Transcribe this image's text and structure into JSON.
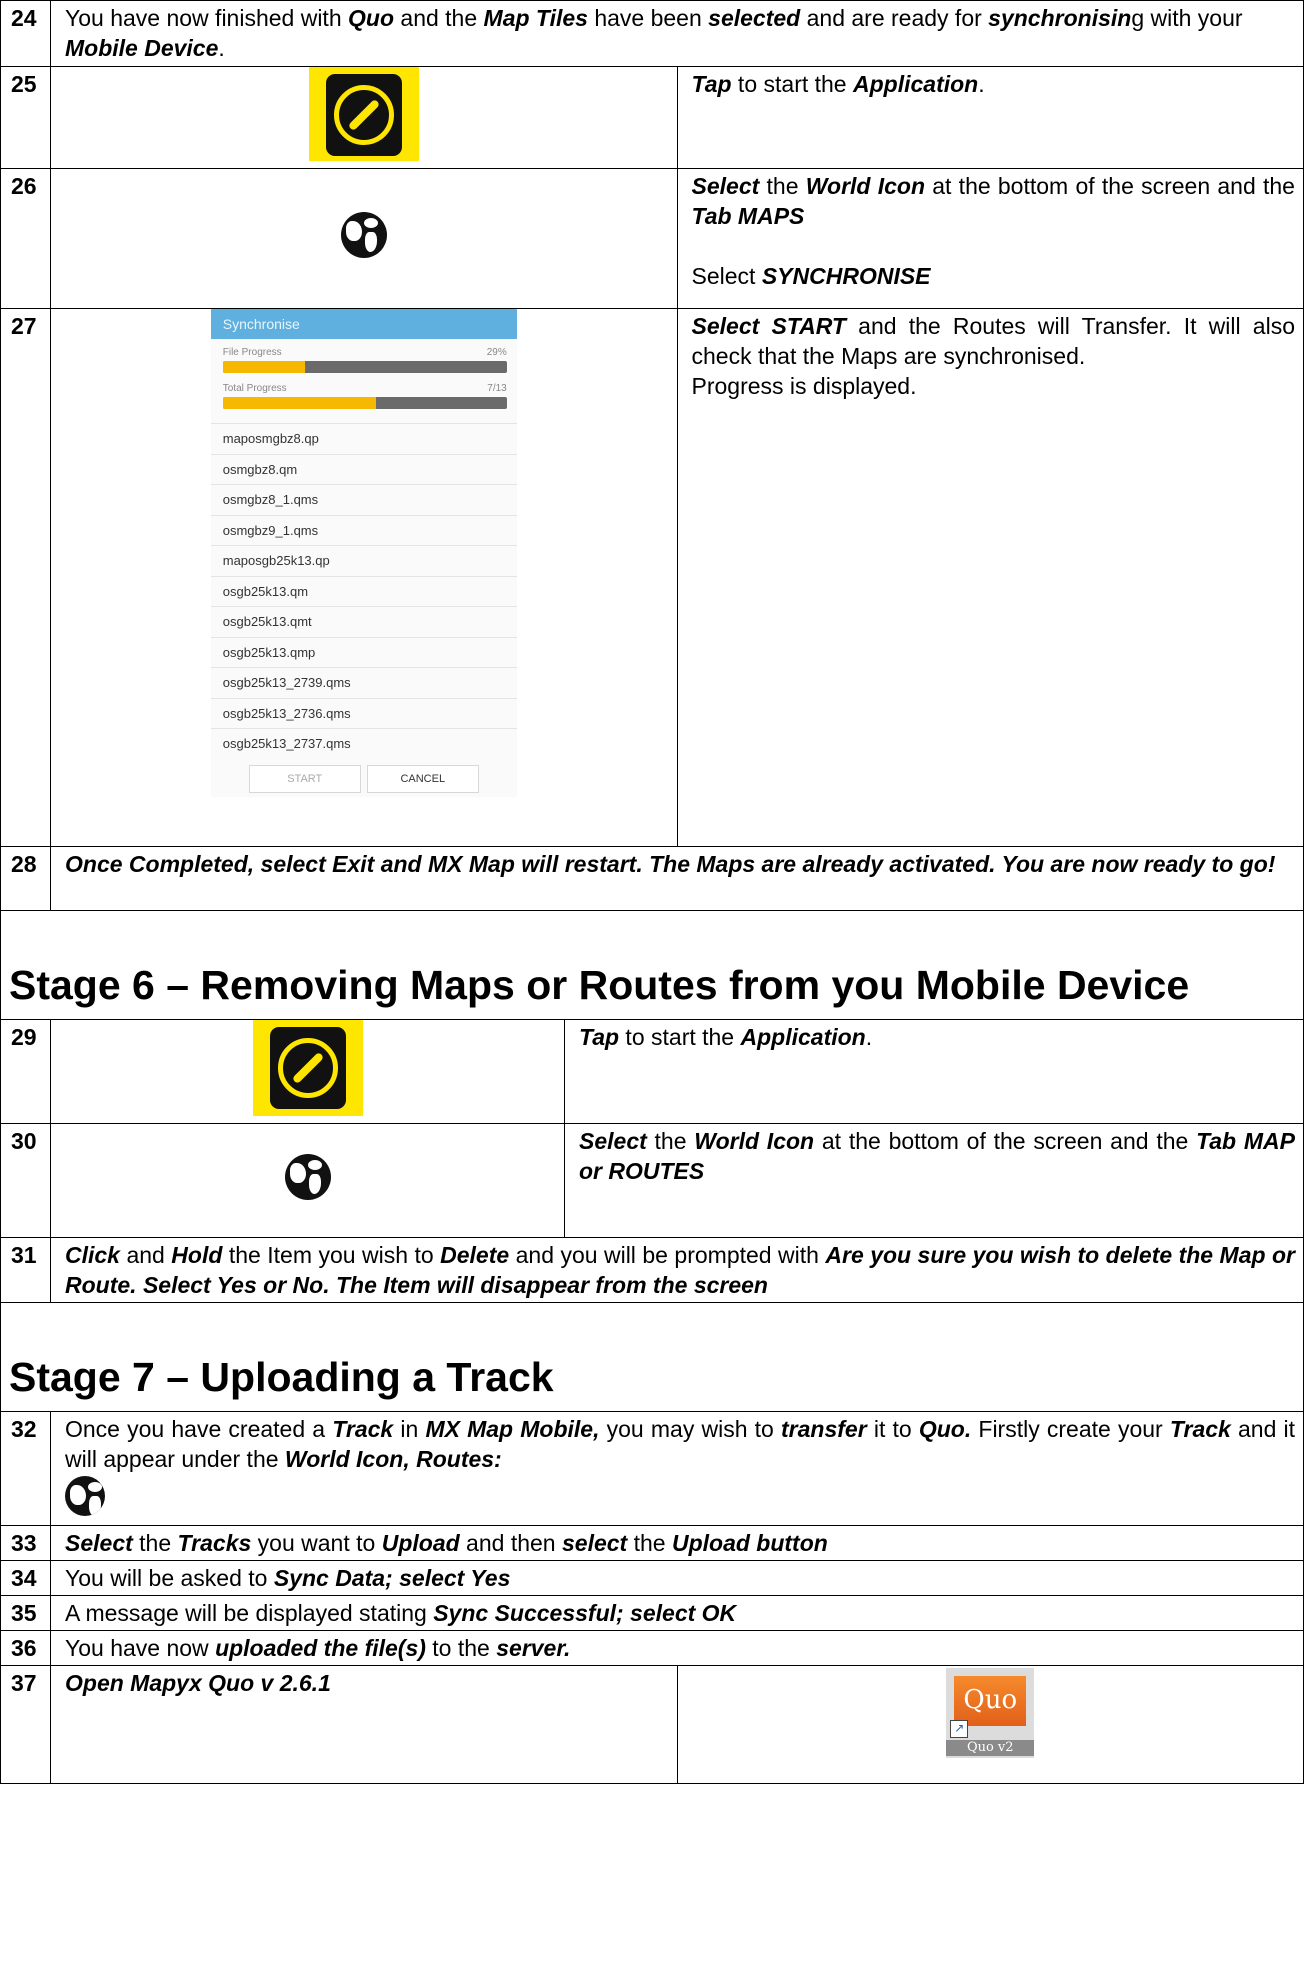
{
  "steps": {
    "s24": {
      "num": "24",
      "t1": "You have now finished with ",
      "b1": "Quo",
      "t2": " and the ",
      "b2": "Map Tiles",
      "t3": " have been ",
      "b3": "selected",
      "t4": " and are ready for ",
      "b4": "synchronisin",
      "t5": "g with your ",
      "b5": "Mobile Device",
      "t6": "."
    },
    "s25": {
      "num": "25",
      "b1": "Tap",
      "t1": " to start the ",
      "b2": "Application",
      "t2": "."
    },
    "s26": {
      "num": "26",
      "b1": "Select",
      "t1": " the ",
      "b2": "World Icon",
      "t2": " at the bottom of the screen and the ",
      "b3": "Tab MAPS",
      "t3": "Select ",
      "b4": "SYNCHRONISE"
    },
    "s27": {
      "num": "27",
      "b1": "Select START",
      "t1": " and the Routes will Transfer.  It will also check that the Maps are synchronised.",
      "t2": "Progress is displayed."
    },
    "s28": {
      "num": "28",
      "text": "Once Completed, select Exit and MX Map will restart.  The Maps are already activated.  You are now ready to go!"
    },
    "s29": {
      "num": "29",
      "b1": "Tap",
      "t1": " to start the ",
      "b2": "Application",
      "t2": "."
    },
    "s30": {
      "num": "30",
      "b1": "Select",
      "t1": " the ",
      "b2": "World Icon",
      "t2": " at the bottom of the screen and the ",
      "b3": "Tab MAP or ROUTES"
    },
    "s31": {
      "num": "31",
      "b1": "Click",
      "t1": " and ",
      "b2": "Hold",
      "t2": " the Item you wish to ",
      "b3": "Delete",
      "t3": " and you will be prompted with ",
      "b4": "Are you sure you wish to delete the Map or Route.  Select Yes or No.  The Item will disappear from the screen"
    },
    "s32": {
      "num": "32",
      "t1": "Once you have created a ",
      "b1": "Track",
      "t2": " in ",
      "b2": "MX Map Mobile,",
      "t3": " you may wish to ",
      "b3": "transfer",
      "t4": " it to ",
      "b4": "Quo.",
      "t5": "  Firstly create your ",
      "b5": "Track",
      "t6": " and it will appear under the ",
      "b6": "World Icon, Routes:"
    },
    "s33": {
      "num": "33",
      "b1": "Select",
      "t1": " the ",
      "b2": "Tracks",
      "t2": " you want to ",
      "b3": "Upload",
      "t3": " and then ",
      "b4": "select",
      "t4": " the ",
      "b5": "Upload button"
    },
    "s34": {
      "num": "34",
      "t1": "You will be asked to ",
      "b1": "Sync Data; select Yes"
    },
    "s35": {
      "num": "35",
      "t1": "A message will be displayed stating ",
      "b1": "Sync Successful; select OK"
    },
    "s36": {
      "num": "36",
      "t1": "You have now ",
      "b1": "uploaded the file(s)",
      "t2": " to the ",
      "b2": "server."
    },
    "s37": {
      "num": "37",
      "b1": "Open Mapyx Quo v 2.6.1"
    }
  },
  "stages": {
    "stage6": "Stage 6 – Removing Maps or Routes from you Mobile Device",
    "stage7": "Stage 7 – Uploading a Track"
  },
  "sync_screen": {
    "title": "Synchronise",
    "file_progress_label": "File Progress",
    "file_progress_value": "29%",
    "file_progress_fraction": 0.29,
    "total_progress_label": "Total Progress",
    "total_progress_value": "7/13",
    "total_progress_fraction": 0.538,
    "files": [
      "maposmgbz8.qp",
      "osmgbz8.qm",
      "osmgbz8_1.qms",
      "osmgbz9_1.qms",
      "maposgb25k13.qp",
      "osgb25k13.qm",
      "osgb25k13.qmt",
      "osgb25k13.qmp",
      "osgb25k13_2739.qms",
      "osgb25k13_2736.qms",
      "osgb25k13_2737.qms"
    ],
    "start_button": "START",
    "cancel_button": "CANCEL",
    "bar_color": "#5fb0df",
    "fill_color": "#f6b800"
  },
  "icons": {
    "app": "compass-app-icon",
    "world": "globe-icon",
    "quo": {
      "name": "quo-shortcut-icon",
      "tile_text": "Quo",
      "label": "Quo v2"
    }
  }
}
